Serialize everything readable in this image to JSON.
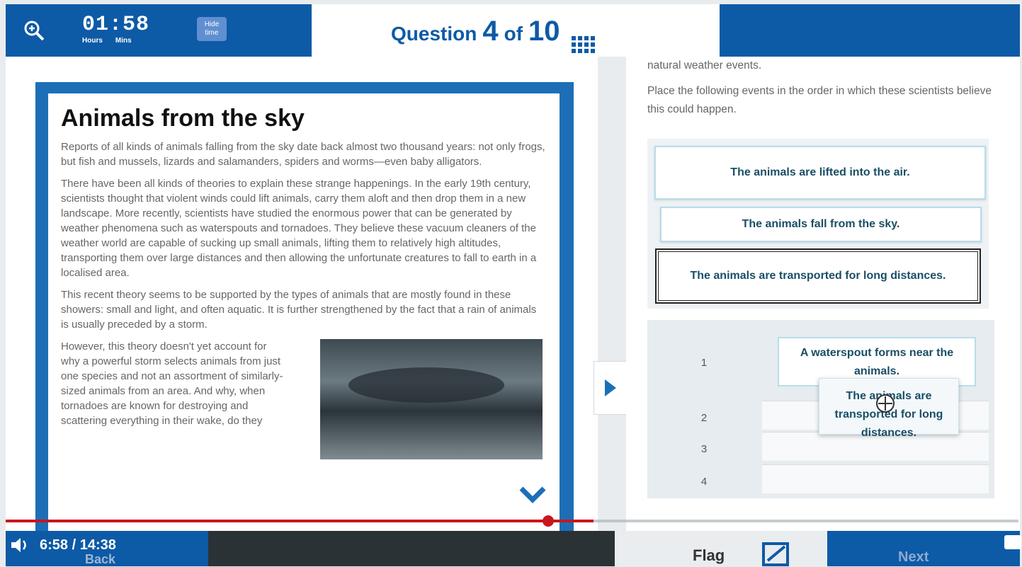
{
  "timer": {
    "value": "01:58",
    "hours_label": "Hours",
    "mins_label": "Mins",
    "hide_label": "Hide time"
  },
  "question": {
    "word": "Question",
    "current": "4",
    "of_word": "of",
    "total": "10"
  },
  "article": {
    "title": "Animals from the sky",
    "paragraphs": [
      "Reports of all kinds of animals falling from the sky date back almost two thousand years: not only frogs, but fish and mussels, lizards and salamanders, spiders and worms—even baby alligators.",
      "There have been all kinds of theories to explain these strange happenings. In the early 19th century, scientists thought that violent winds could lift animals, carry them aloft and then drop them in a new landscape. More recently, scientists have studied the enormous power that can be generated by weather phenomena such as waterspouts and tornadoes. They believe these vacuum cleaners of the weather world are capable of sucking up small animals, lifting them to relatively high altitudes, transporting them over large distances and then allowing the unfortunate creatures to fall to earth in a localised area.",
      "This recent theory seems to be supported by the types of animals that are mostly found in these showers: small and light, and often aquatic. It is further strengthened by the fact that a rain of animals is usually preceded by a storm."
    ],
    "last_paragraph": "However, this theory doesn't yet account for why a powerful storm selects animals from just one species and not an assortment of similarly-sized animals from an area. And why, when tornadoes are known for destroying and scattering everything in their wake, do they"
  },
  "instructions": {
    "line1": "natural weather events.",
    "line2": "Place the following events in the order in which these scientists believe this could happen."
  },
  "cards": [
    "The animals are lifted into the air.",
    "The animals fall from the sky.",
    "The animals are transported for long distances."
  ],
  "order": {
    "numbers": [
      "1",
      "2",
      "3",
      "4"
    ],
    "placed": "A waterspout forms near the animals.",
    "dragging": "The animals are transported for long distances."
  },
  "video": {
    "time": "6:58 / 14:38",
    "progress": 0.4755
  },
  "footer": {
    "back": "Back",
    "flag": "Flag",
    "next": "Next"
  }
}
